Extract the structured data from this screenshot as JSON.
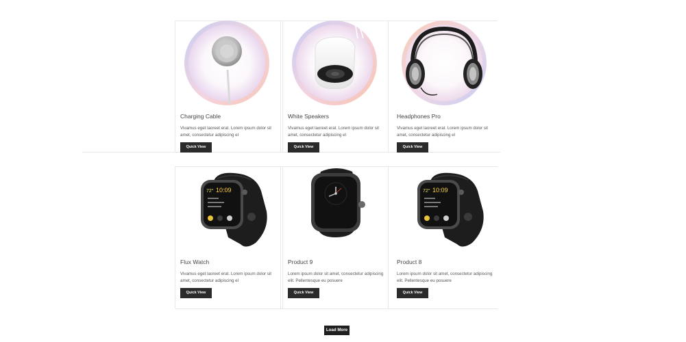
{
  "products": [
    {
      "title": "Charging Cable",
      "description": "Vivamus eget laoreet erat. Lorem ipsum dolor sit amet, consectetur adipiscing el",
      "button_label": "Quick View",
      "icon": "charging-cable-image"
    },
    {
      "title": "White Speakers",
      "description": "Vivamus eget laoreet erat. Lorem ipsum dolor sit amet, consectetur adipiscing el",
      "button_label": "Quick View",
      "icon": "white-speaker-image"
    },
    {
      "title": "Headphones Pro",
      "description": "Vivamus eget laoreet erat. Lorem ipsum dolor sit amet, consectetur adipiscing el",
      "button_label": "Quick View",
      "icon": "headphones-image"
    },
    {
      "title": "Flux Watch",
      "description": "Vivamus eget laoreet erat. Lorem ipsum dolor sit amet, consectetur adipiscing el",
      "button_label": "Quick View",
      "icon": "smartwatch-image"
    },
    {
      "title": "Product 9",
      "description": "Lorem ipsum dolor sit amet, consectetur adipiscing elit. Pellentesque eu posuere",
      "button_label": "Quick View",
      "icon": "smartwatch-image"
    },
    {
      "title": "Product 8",
      "description": "Lorem ipsum dolor sit amet, consectetur adipiscing elit. Pellentesque eu posuere",
      "button_label": "Quick View",
      "icon": "smartwatch-image"
    }
  ],
  "watch_face": {
    "temperature": "72°",
    "time": "10:09"
  },
  "load_more_label": "Load More",
  "colors": {
    "button_bg": "#2b2b2b",
    "grid_line": "#e8e8e8",
    "page_bg": "#ffffff"
  }
}
